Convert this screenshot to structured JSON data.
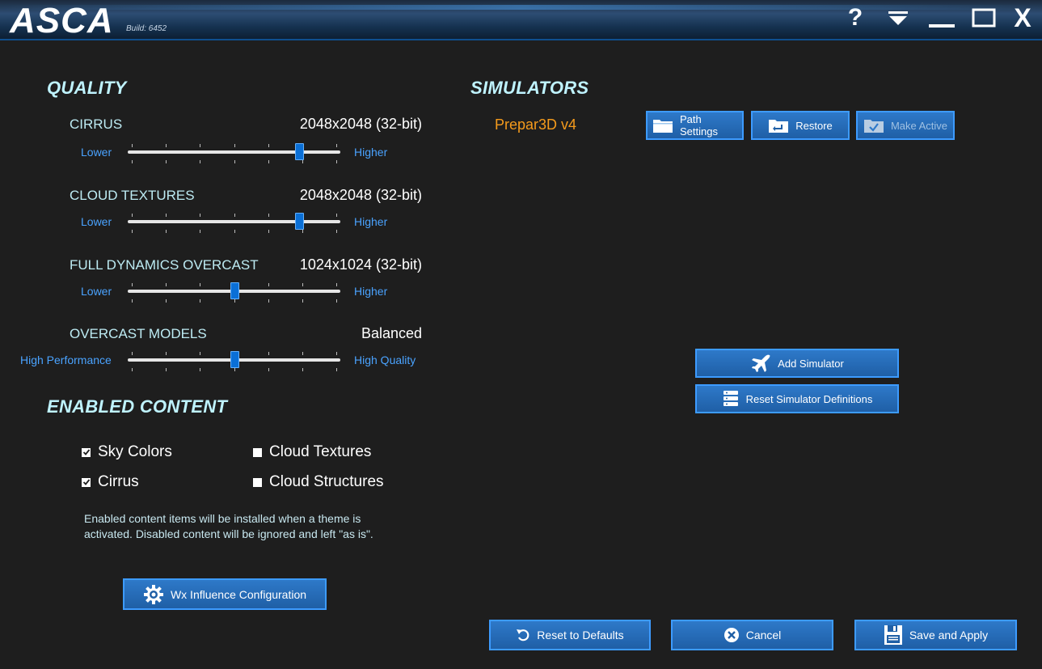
{
  "app": {
    "title": "ASCA",
    "build": "Build: 6452"
  },
  "window_controls": {
    "help": "?",
    "close": "X"
  },
  "quality": {
    "title": "QUALITY",
    "settings": [
      {
        "name": "CIRRUS",
        "value": "2048x2048 (32-bit)",
        "low_label": "Lower",
        "high_label": "Higher",
        "level": 0.82
      },
      {
        "name": "CLOUD TEXTURES",
        "value": "2048x2048 (32-bit)",
        "low_label": "Lower",
        "high_label": "Higher",
        "level": 0.82
      },
      {
        "name": "FULL DYNAMICS OVERCAST",
        "value": "1024x1024 (32-bit)",
        "low_label": "Lower",
        "high_label": "Higher",
        "level": 0.5
      },
      {
        "name": "OVERCAST MODELS",
        "value": "Balanced",
        "low_label": "High Performance",
        "high_label": "High Quality",
        "level": 0.5
      }
    ]
  },
  "enabled_content": {
    "title": "ENABLED CONTENT",
    "items": [
      {
        "label": "Sky Colors",
        "checked": true
      },
      {
        "label": "Cloud Textures",
        "checked": false
      },
      {
        "label": "Cirrus",
        "checked": true
      },
      {
        "label": "Cloud Structures",
        "checked": false
      }
    ],
    "note": "Enabled content items will be installed when a theme is activated.  Disabled content will be ignored and left \"as is\".",
    "wx_button": "Wx Influence Configuration"
  },
  "simulators": {
    "title": "SIMULATORS",
    "entries": [
      {
        "name": "Prepar3D v4"
      }
    ],
    "path_settings": "Path Settings",
    "restore": "Restore",
    "make_active": "Make Active",
    "add_simulator": "Add Simulator",
    "reset_definitions": "Reset Simulator Definitions"
  },
  "footer": {
    "reset_defaults": "Reset to Defaults",
    "cancel": "Cancel",
    "save_apply": "Save and Apply"
  },
  "colors": {
    "background": "#1e1e1e",
    "accent": "#2e79c9",
    "heading": "#bff3ff",
    "sim_name": "#f59b1c",
    "slider_label": "#4aa3ff"
  }
}
